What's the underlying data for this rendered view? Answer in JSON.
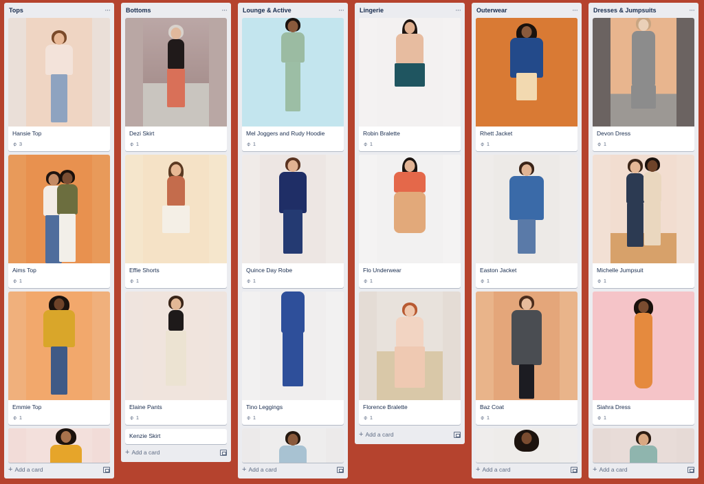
{
  "colors": {
    "board_bg": "#b5432e",
    "list_bg": "#ebecf0",
    "text": "#172b4d",
    "muted": "#5e6c84"
  },
  "ui": {
    "add_card": "Add a card",
    "more_icon": "more-horizontal-icon",
    "attachment_icon": "paperclip-icon",
    "template_icon": "card-template-icon"
  },
  "lists": [
    {
      "title": "Tops",
      "cards": [
        {
          "title": "Hansie Top",
          "attachments": "3"
        },
        {
          "title": "Aims Top",
          "attachments": "1"
        },
        {
          "title": "Emmie Top",
          "attachments": "1"
        }
      ]
    },
    {
      "title": "Bottoms",
      "cards": [
        {
          "title": "Dezi Skirt",
          "attachments": "1"
        },
        {
          "title": "Effie Shorts",
          "attachments": "1"
        },
        {
          "title": "Elaine Pants",
          "attachments": "1"
        },
        {
          "title": "Kenzie Skirt"
        }
      ]
    },
    {
      "title": "Lounge & Active",
      "cards": [
        {
          "title": "Mel Joggers and Rudy Hoodie",
          "attachments": "1"
        },
        {
          "title": "Quince Day Robe",
          "attachments": "1"
        },
        {
          "title": "Tino Leggings",
          "attachments": "1"
        }
      ]
    },
    {
      "title": "Lingerie",
      "cards": [
        {
          "title": "Robin Bralette",
          "attachments": "1"
        },
        {
          "title": "Flo Underwear",
          "attachments": "1"
        },
        {
          "title": "Florence Bralette",
          "attachments": "1"
        }
      ]
    },
    {
      "title": "Outerwear",
      "cards": [
        {
          "title": "Rhett Jacket",
          "attachments": "1"
        },
        {
          "title": "Easton Jacket",
          "attachments": "1"
        },
        {
          "title": "Baz Coat",
          "attachments": "1"
        }
      ]
    },
    {
      "title": "Dresses & Jumpsuits",
      "cards": [
        {
          "title": "Devon Dress",
          "attachments": "1"
        },
        {
          "title": "Michelle Jumpsuit",
          "attachments": "1"
        },
        {
          "title": "Siahra Dress",
          "attachments": "1"
        }
      ]
    }
  ]
}
